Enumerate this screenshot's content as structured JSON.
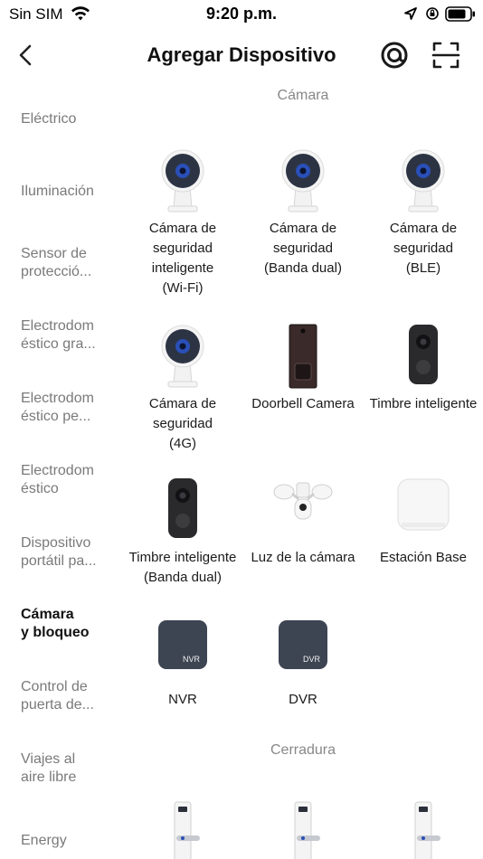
{
  "status_bar": {
    "carrier": "Sin SIM",
    "time": "9:20 p.m."
  },
  "nav": {
    "title": "Agregar Dispositivo"
  },
  "sidebar": {
    "items": [
      {
        "label": "Eléctrico",
        "active": false
      },
      {
        "label": "Iluminación",
        "active": false
      },
      {
        "label": "Sensor de\nprotecció...",
        "active": false
      },
      {
        "label": "Electrodom\néstico gra...",
        "active": false
      },
      {
        "label": "Electrodom\néstico pe...",
        "active": false
      },
      {
        "label": "Electrodom\néstico",
        "active": false
      },
      {
        "label": "Dispositivo\nportátil pa...",
        "active": false
      },
      {
        "label": "Cámara\ny bloqueo",
        "active": true
      },
      {
        "label": "Control de\npuerta de...",
        "active": false
      },
      {
        "label": "Viajes al\naire libre",
        "active": false
      },
      {
        "label": "Energy",
        "active": false
      }
    ]
  },
  "sections": [
    {
      "title": "Cámara",
      "devices": [
        {
          "name": "Cámara de\nseguridad\ninteligente\n(Wi-Fi)",
          "icon": "security-camera-icon"
        },
        {
          "name": "Cámara de\nseguridad\n(Banda dual)",
          "icon": "security-camera-icon"
        },
        {
          "name": "Cámara de\nseguridad\n(BLE)",
          "icon": "security-camera-icon"
        },
        {
          "name": "Cámara de\nseguridad\n(4G)",
          "icon": "security-camera-icon"
        },
        {
          "name": "Doorbell Camera",
          "icon": "doorbell-camera-icon"
        },
        {
          "name": "Timbre inteligente",
          "icon": "smart-doorbell-icon"
        },
        {
          "name": "Timbre inteligente\n(Banda dual)",
          "icon": "smart-doorbell-icon"
        },
        {
          "name": "Luz de la cámara",
          "icon": "floodlight-camera-icon"
        },
        {
          "name": "Estación Base",
          "icon": "base-station-icon"
        },
        {
          "name": "NVR",
          "icon": "nvr-icon",
          "badge": "NVR"
        },
        {
          "name": "DVR",
          "icon": "dvr-icon",
          "badge": "DVR"
        }
      ]
    },
    {
      "title": "Cerradura",
      "devices": [
        {
          "name": "",
          "icon": "door-lock-icon"
        },
        {
          "name": "",
          "icon": "door-lock-icon"
        },
        {
          "name": "",
          "icon": "door-lock-icon"
        }
      ]
    }
  ],
  "colors": {
    "accent_blue": "#2a4fb8",
    "muted_text": "#7a7a7a",
    "recorder_dark": "#3d4452"
  }
}
